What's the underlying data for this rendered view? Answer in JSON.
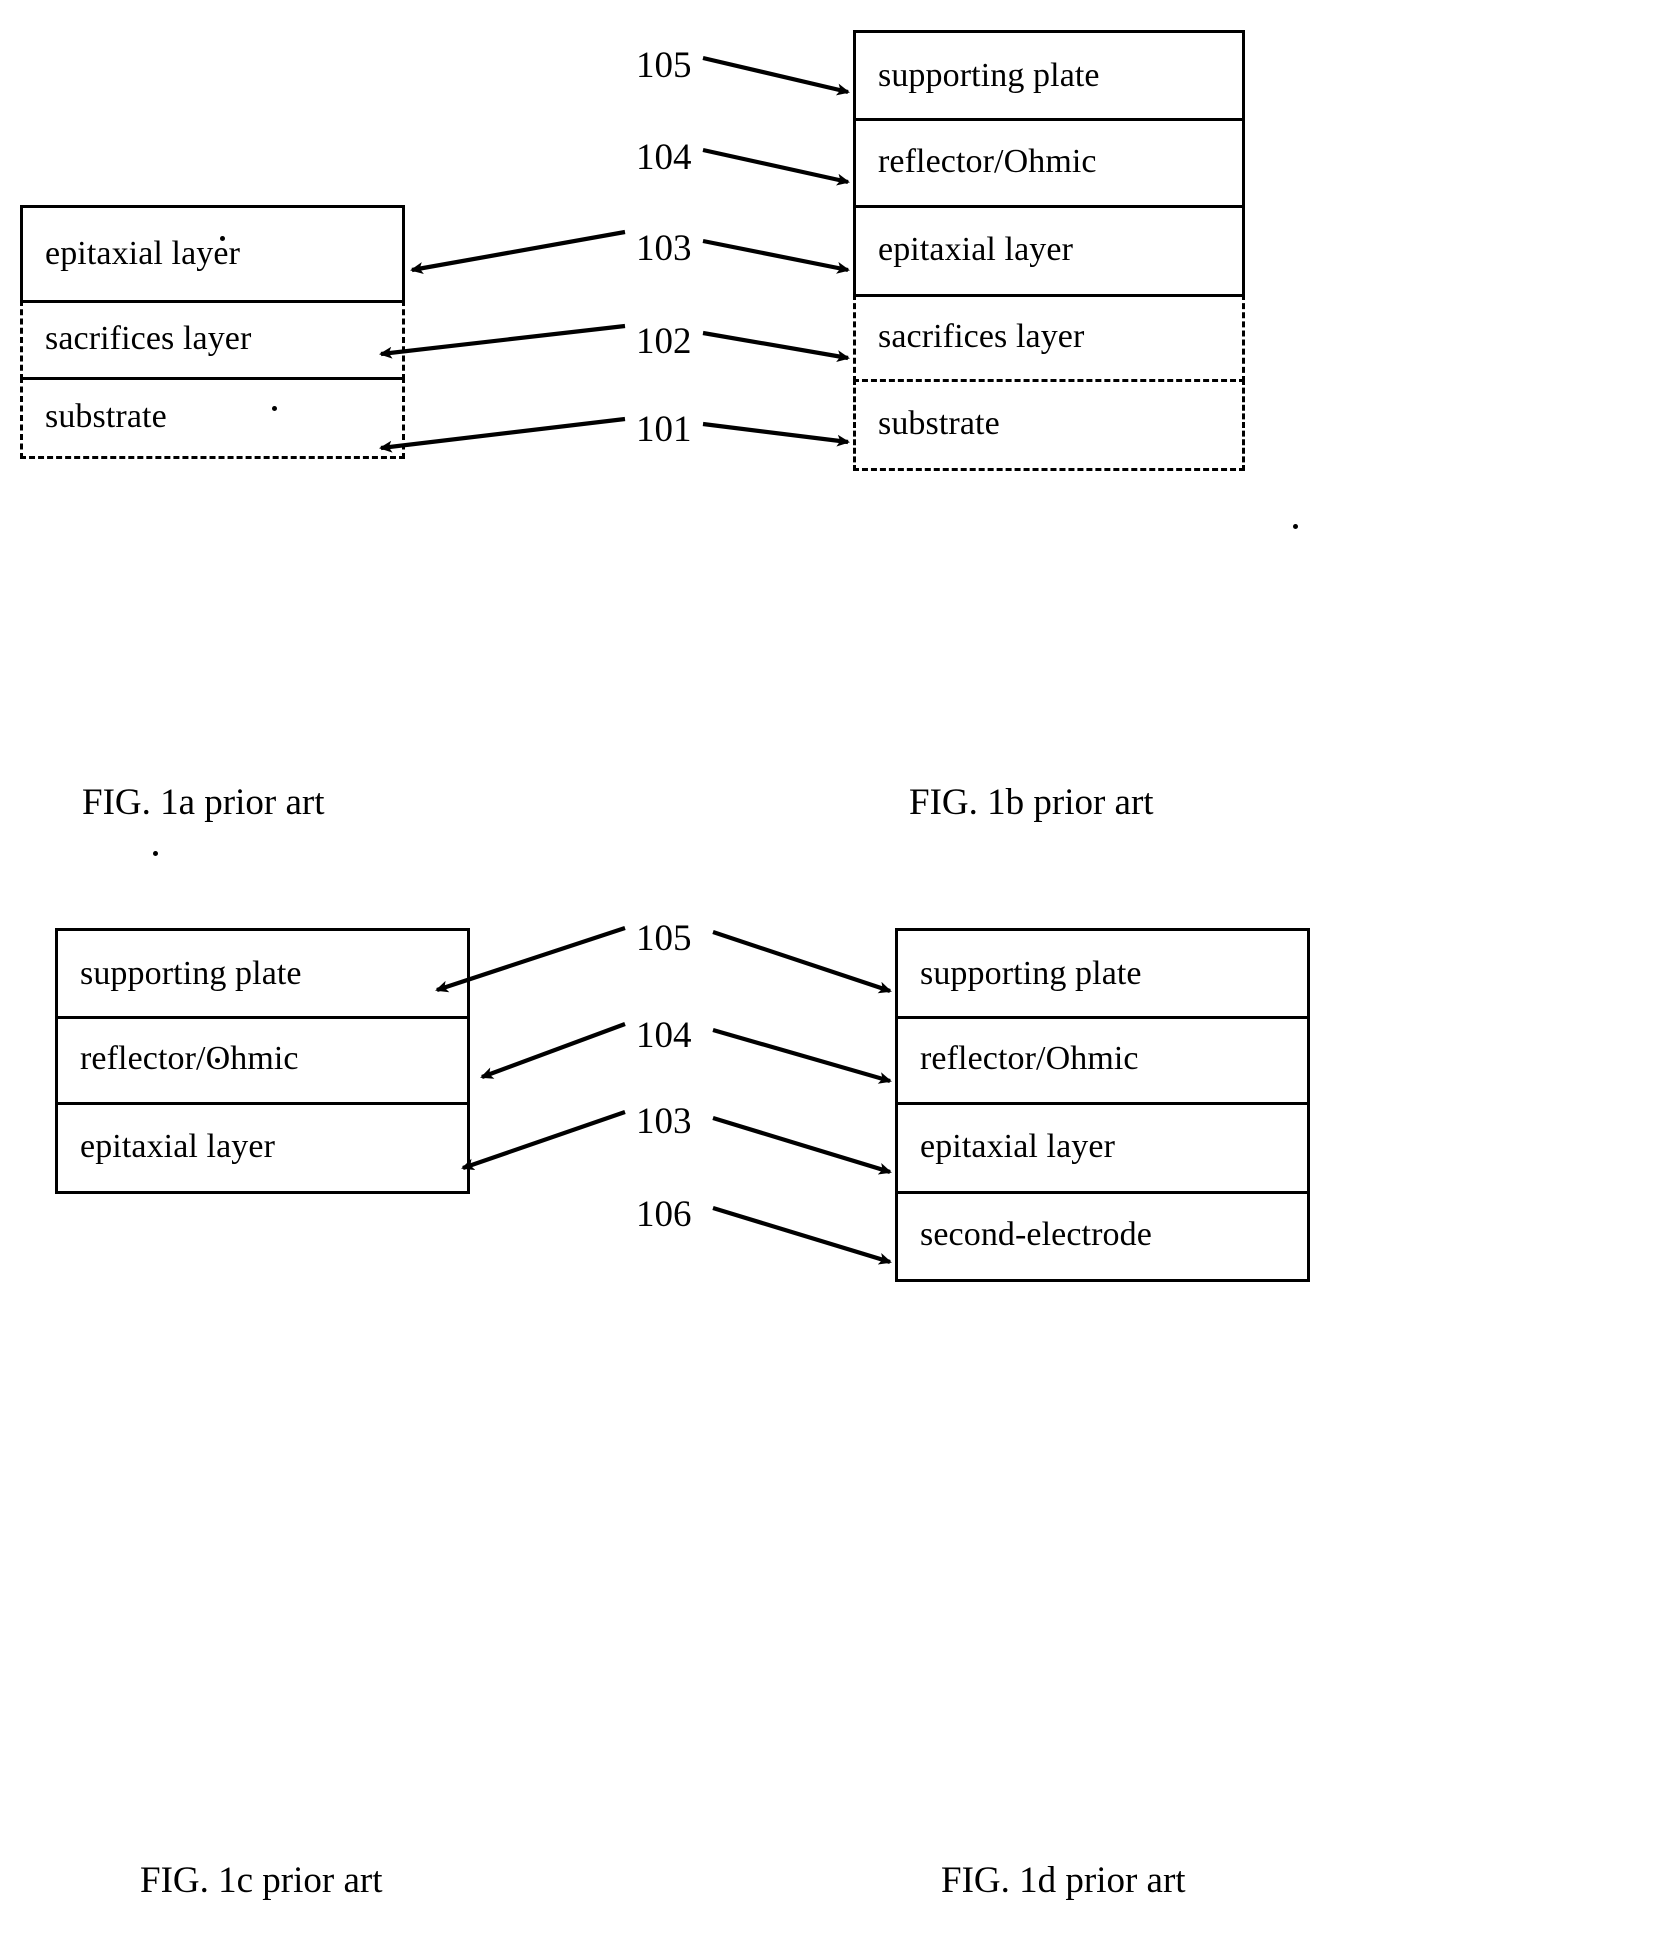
{
  "figures": [
    {
      "id": "fig-1a",
      "caption": "FIG. 1a prior art",
      "layers": [
        {
          "label": "epitaxial layer",
          "style": "solid"
        },
        {
          "label": "sacrifices layer",
          "style": "dashed-sides"
        },
        {
          "label": "substrate",
          "style": "dashed"
        }
      ]
    },
    {
      "id": "fig-1b",
      "caption": "FIG. 1b prior art",
      "layers": [
        {
          "label": "supporting plate",
          "style": "solid"
        },
        {
          "label": "reflector/Ohmic",
          "style": "solid"
        },
        {
          "label": "epitaxial layer",
          "style": "solid"
        },
        {
          "label": "sacrifices layer",
          "style": "dashed-sides"
        },
        {
          "label": "substrate",
          "style": "dashed"
        }
      ]
    },
    {
      "id": "fig-1c",
      "caption": "FIG. 1c prior art",
      "layers": [
        {
          "label": "supporting plate",
          "style": "solid"
        },
        {
          "label": "reflector/Ohmic",
          "style": "solid"
        },
        {
          "label": "epitaxial layer",
          "style": "solid"
        }
      ]
    },
    {
      "id": "fig-1d",
      "caption": "FIG. 1d prior art",
      "layers": [
        {
          "label": "supporting plate",
          "style": "solid"
        },
        {
          "label": "reflector/Ohmic",
          "style": "solid"
        },
        {
          "label": "epitaxial layer",
          "style": "solid"
        },
        {
          "label": "second-electrode",
          "style": "solid"
        }
      ]
    }
  ],
  "reference_numerals": {
    "top": [
      {
        "number": "105",
        "points_to": [
          "fig-1b.supporting plate"
        ]
      },
      {
        "number": "104",
        "points_to": [
          "fig-1b.reflector/Ohmic"
        ]
      },
      {
        "number": "103",
        "points_to": [
          "fig-1a.epitaxial layer",
          "fig-1b.epitaxial layer"
        ]
      },
      {
        "number": "102",
        "points_to": [
          "fig-1a.sacrifices layer",
          "fig-1b.sacrifices layer"
        ]
      },
      {
        "number": "101",
        "points_to": [
          "fig-1a.substrate",
          "fig-1b.substrate"
        ]
      }
    ],
    "bottom": [
      {
        "number": "105",
        "points_to": [
          "fig-1c.supporting plate",
          "fig-1d.supporting plate"
        ]
      },
      {
        "number": "104",
        "points_to": [
          "fig-1c.reflector/Ohmic",
          "fig-1d.reflector/Ohmic"
        ]
      },
      {
        "number": "103",
        "points_to": [
          "fig-1c.epitaxial layer",
          "fig-1d.epitaxial layer"
        ]
      },
      {
        "number": "106",
        "points_to": [
          "fig-1d.second-electrode"
        ]
      }
    ]
  },
  "colors": {
    "ink": "#000000",
    "paper": "#ffffff"
  }
}
